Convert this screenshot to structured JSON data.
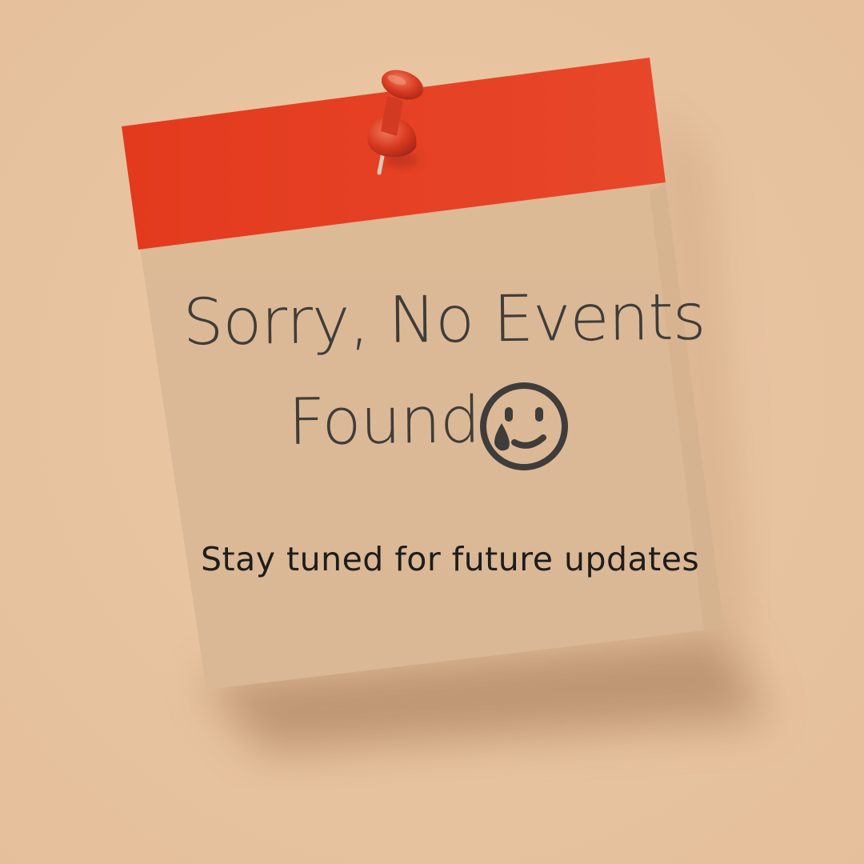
{
  "note": {
    "headline_line1": "Sorry, No Events",
    "headline_line2": "Found",
    "subtitle": "Stay tuned for future updates",
    "icon": "crying-face-icon"
  },
  "colors": {
    "background": "#e8c3a0",
    "note_paper": "#dcbb98",
    "note_header": "#e23e20",
    "pin": "#d83a20",
    "text": "#3f3d3b"
  }
}
